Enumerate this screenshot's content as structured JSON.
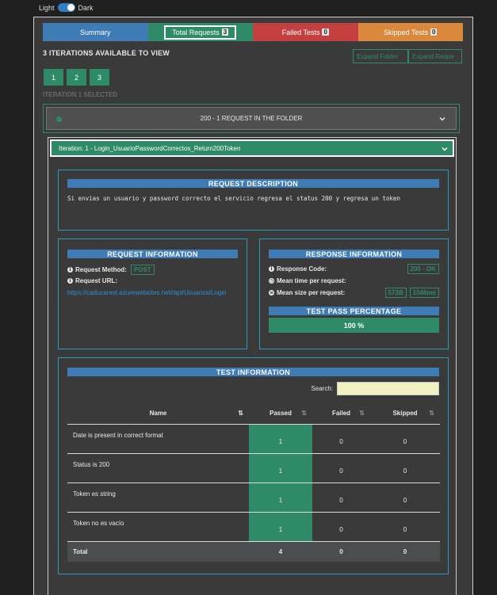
{
  "theme": {
    "light_label": "Light",
    "dark_label": "Dark"
  },
  "tabs": {
    "summary": "Summary",
    "total": {
      "label": "Total Requests",
      "count": "3"
    },
    "failed": {
      "label": "Failed Tests",
      "count": "0"
    },
    "skipped": {
      "label": "Skipped Tests",
      "count": "0"
    }
  },
  "iterations": {
    "heading": "3 ITERATIONS AVAILABLE TO VIEW",
    "buttons": [
      "1",
      "2",
      "3"
    ],
    "selected": "ITERATION 1 SELECTED",
    "expand_folder": "Expand Folder",
    "expand_requests": "Expand Reque"
  },
  "folder": {
    "label": "200 - 1 REQUEST IN THE FOLDER"
  },
  "iteration_bar": {
    "label": "Iteration: 1 - Login_UsuarioPasswordCorrectos_Return200Token"
  },
  "request_description": {
    "title": "REQUEST DESCRIPTION",
    "text": "Si envias un usuario y password correcto el servicio regresa el status 200 y regresa un token"
  },
  "request_information": {
    "title": "REQUEST INFORMATION",
    "method_label": "Request Method:",
    "method": "POST",
    "url_label": "Request URL:",
    "url": "https://caducarest.azurewebsites.net//api/Usuarios/Login"
  },
  "response_information": {
    "title": "RESPONSE INFORMATION",
    "code_label": "Response Code:",
    "code": "200 - OK",
    "time_label": "Mean time per request:",
    "size_label": "Mean size per request:",
    "size": "573B",
    "time": "1046ms",
    "pass_title": "TEST PASS PERCENTAGE",
    "pass_value": "100 %"
  },
  "test_information": {
    "title": "TEST INFORMATION",
    "search_label": "Search:",
    "search_value": "",
    "columns": {
      "name": "Name",
      "passed": "Passed",
      "failed": "Failed",
      "skipped": "Skipped"
    },
    "rows": [
      {
        "name": "Date is present in correct format",
        "passed": "1",
        "failed": "0",
        "skipped": "0"
      },
      {
        "name": "Status is 200",
        "passed": "1",
        "failed": "0",
        "skipped": "0"
      },
      {
        "name": "Token es string",
        "passed": "1",
        "failed": "0",
        "skipped": "0"
      },
      {
        "name": "Token no es vacío",
        "passed": "1",
        "failed": "0",
        "skipped": "0"
      }
    ],
    "total": {
      "name": "Total",
      "passed": "4",
      "failed": "0",
      "skipped": "0"
    }
  },
  "colors": {
    "accent_green": "#2e8a67",
    "accent_blue": "#3f7bb5",
    "failed_red": "#c44040",
    "skipped_orange": "#d9883c"
  }
}
